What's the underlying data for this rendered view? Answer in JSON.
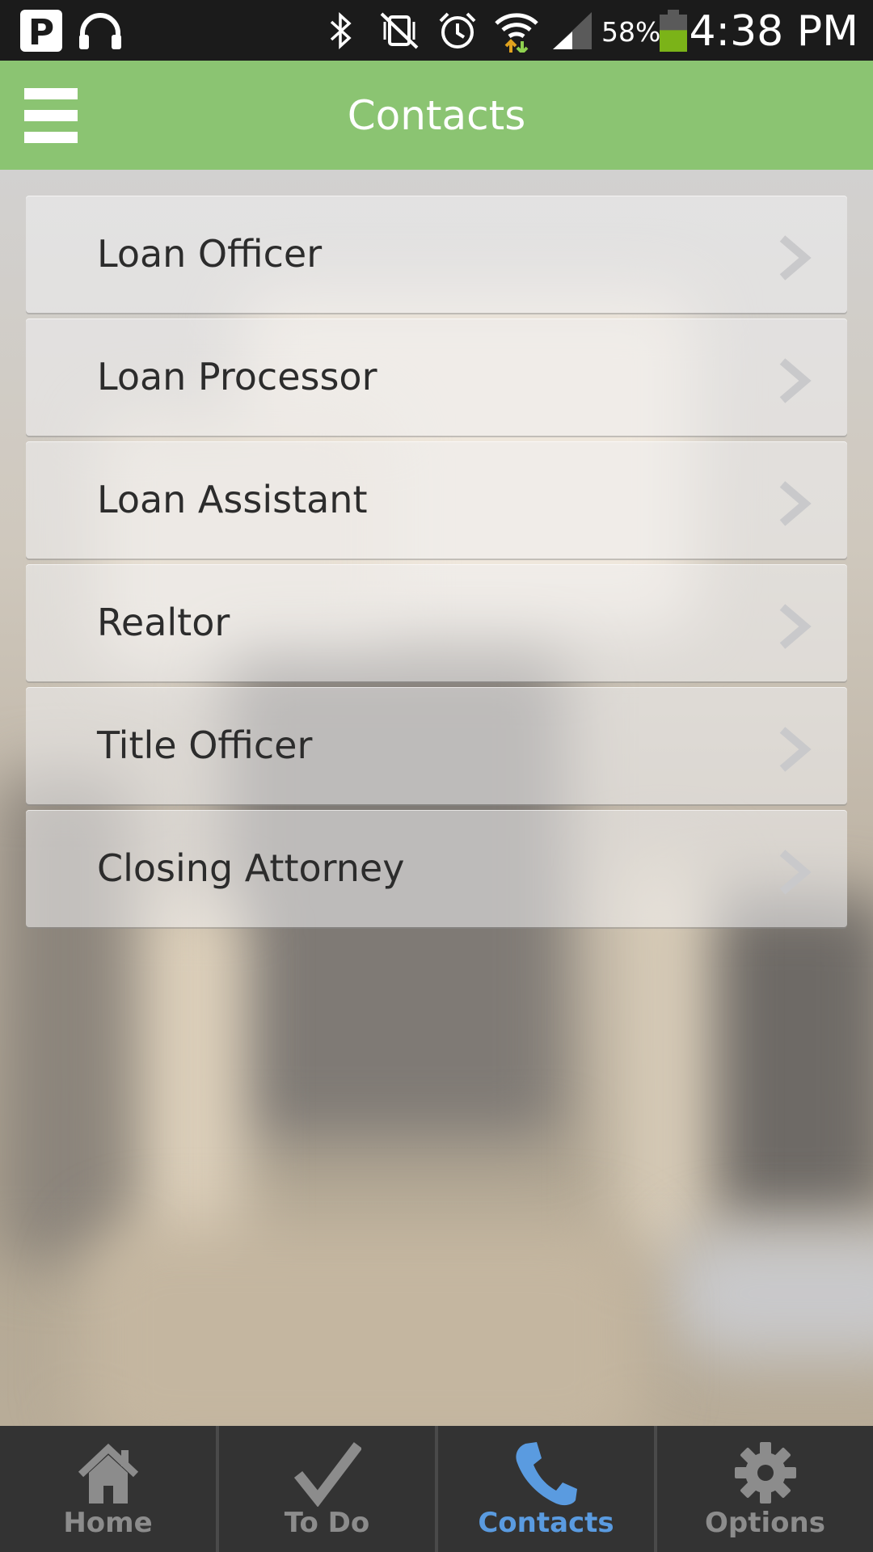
{
  "status_bar": {
    "time": "4:38 PM",
    "battery_percent": "58%",
    "battery_level": 0.58,
    "icons": [
      "parking-app-icon",
      "headphones-icon",
      "bluetooth-icon",
      "vibrate-mute-icon",
      "alarm-icon",
      "wifi-icon",
      "cell-signal-icon",
      "battery-icon"
    ]
  },
  "header": {
    "title": "Contacts",
    "menu_icon": "hamburger-menu-icon",
    "background_color": "#8bc472"
  },
  "contacts": {
    "items": [
      {
        "label": "Loan Officer"
      },
      {
        "label": "Loan Processor"
      },
      {
        "label": "Loan Assistant"
      },
      {
        "label": "Realtor"
      },
      {
        "label": "Title Officer"
      },
      {
        "label": "Closing Attorney"
      }
    ],
    "chevron_icon": "chevron-right-icon"
  },
  "tabbar": {
    "tabs": [
      {
        "label": "Home",
        "icon": "home-icon",
        "active": false
      },
      {
        "label": "To Do",
        "icon": "checkmark-icon",
        "active": false
      },
      {
        "label": "Contacts",
        "icon": "phone-icon",
        "active": true
      },
      {
        "label": "Options",
        "icon": "gear-icon",
        "active": false
      }
    ],
    "active_color": "#5a9be0",
    "inactive_color": "#8c8c8c"
  }
}
